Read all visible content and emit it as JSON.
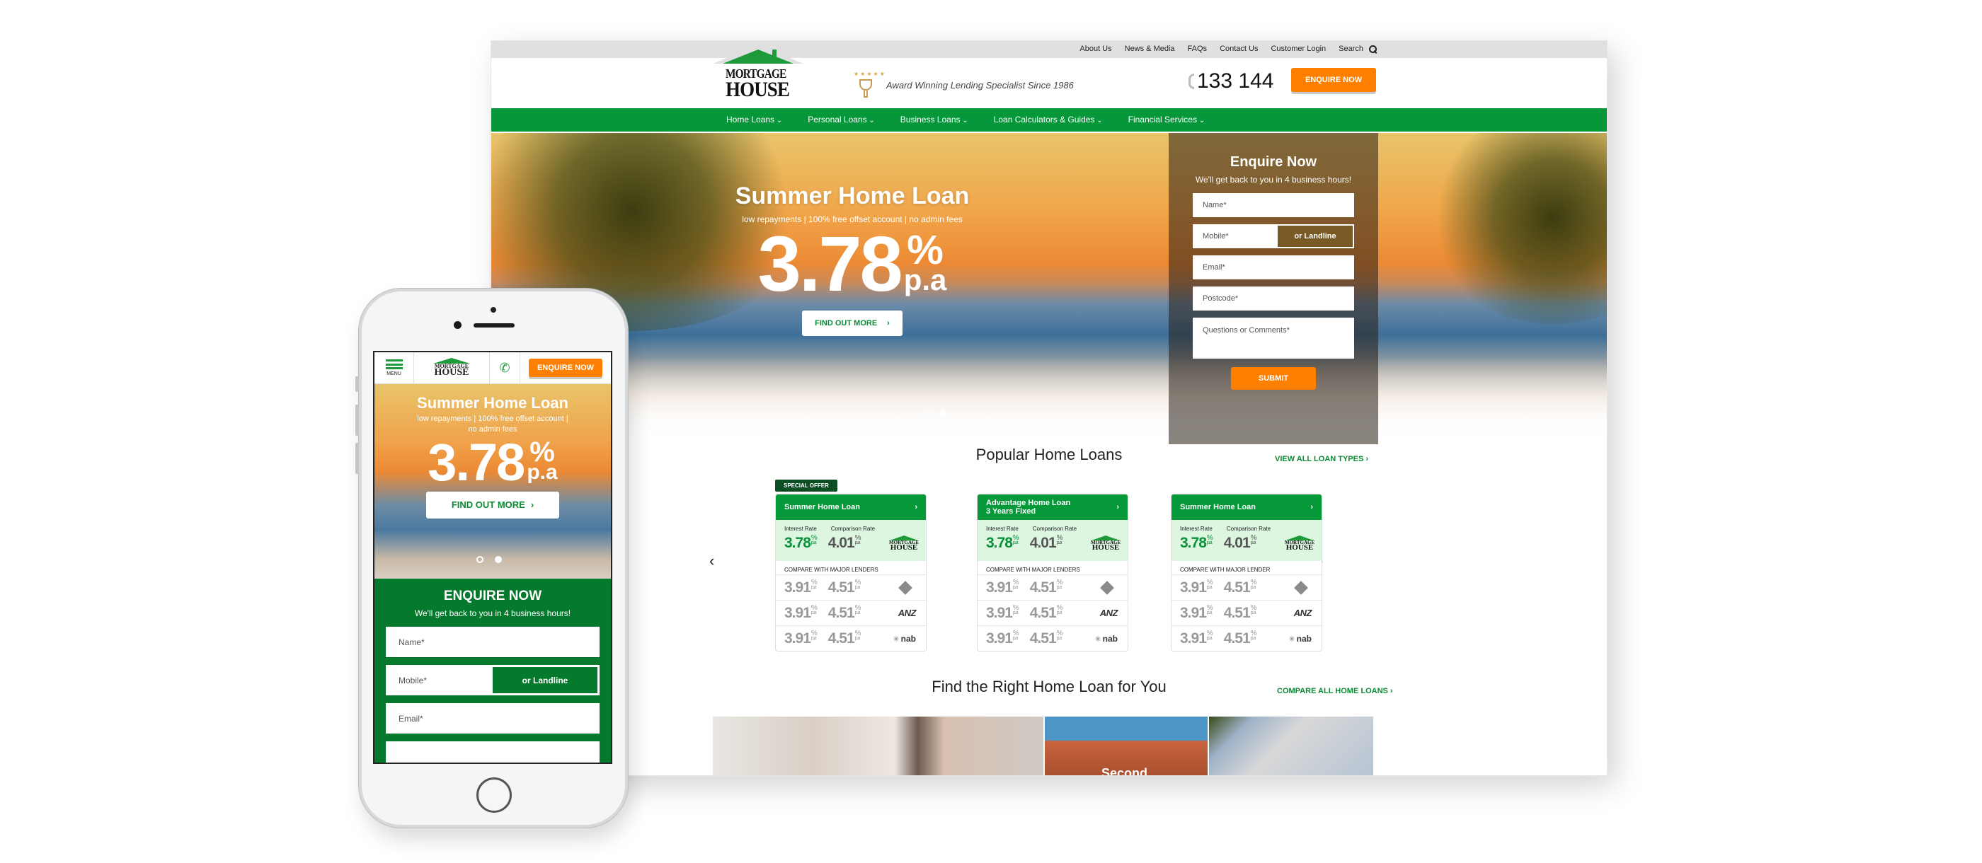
{
  "desktop": {
    "top_links": [
      "About Us",
      "News & Media",
      "FAQs",
      "Contact Us",
      "Customer Login",
      "Search"
    ],
    "logo": {
      "line1": "MORTGAGE",
      "line2": "HOUSE"
    },
    "award_text": "Award Winning Lending Specialist Since 1986",
    "phone_number": "133 144",
    "enquire_button": "ENQUIRE NOW",
    "nav": [
      "Home Loans",
      "Personal Loans",
      "Business Loans",
      "Loan Calculators & Guides",
      "Financial Services"
    ],
    "hero": {
      "title": "Summer Home Loan",
      "subtitle": "low repayments  |  100% free offset account  |  no admin fees",
      "rate": "3.78",
      "rate_unit": "%",
      "rate_suffix": "p.a",
      "cta": "FIND OUT MORE",
      "slides": 2,
      "active_slide": 2
    },
    "enquire_form": {
      "title": "Enquire Now",
      "subtitle": "We'll get back to you in 4 business hours!",
      "name_placeholder": "Name*",
      "mobile_placeholder": "Mobile*",
      "landline_toggle": "or Landline",
      "email_placeholder": "Email*",
      "postcode_placeholder": "Postcode*",
      "comments_placeholder": "Questions or Comments*",
      "submit": "SUBMIT"
    },
    "popular": {
      "title": "Popular Home Loans",
      "view_all": "VIEW ALL LOAN TYPES",
      "cards": [
        {
          "badge": "SPECIAL OFFER",
          "name": "Summer Home Loan",
          "interest_label": "Interest Rate",
          "comparison_label": "Comparison Rate",
          "interest_rate": "3.78",
          "comparison_rate": "4.01",
          "compare_title": "COMPARE WITH MAJOR LENDERS",
          "lenders": [
            {
              "name": "CBA",
              "interest": "3.91",
              "comparison": "4.51"
            },
            {
              "name": "ANZ",
              "interest": "3.91",
              "comparison": "4.51"
            },
            {
              "name": "nab",
              "interest": "3.91",
              "comparison": "4.51"
            }
          ]
        },
        {
          "badge": "",
          "name_line1": "Advantage Home Loan",
          "name_line2": "3 Years Fixed",
          "interest_label": "Interest Rate",
          "comparison_label": "Comparison Rate",
          "interest_rate": "3.78",
          "comparison_rate": "4.01",
          "compare_title": "COMPARE WITH MAJOR LENDERS",
          "lenders": [
            {
              "name": "CBA",
              "interest": "3.91",
              "comparison": "4.51"
            },
            {
              "name": "ANZ",
              "interest": "3.91",
              "comparison": "4.51"
            },
            {
              "name": "nab",
              "interest": "3.91",
              "comparison": "4.51"
            }
          ]
        },
        {
          "badge": "",
          "name": "Summer Home Loan",
          "interest_label": "Interest Rate",
          "comparison_label": "Comparison Rate",
          "interest_rate": "3.78",
          "comparison_rate": "4.01",
          "compare_title": "COMPARE WITH MAJOR LENDER",
          "lenders": [
            {
              "name": "CBA",
              "interest": "3.91",
              "comparison": "4.51"
            },
            {
              "name": "ANZ",
              "interest": "3.91",
              "comparison": "4.51"
            },
            {
              "name": "nab",
              "interest": "3.91",
              "comparison": "4.51"
            }
          ]
        }
      ],
      "pct": "%",
      "pa": "p.a"
    },
    "find": {
      "title": "Find the Right Home Loan for You",
      "compare_all": "COMPARE ALL HOME LOANS",
      "tile_label": "Second"
    }
  },
  "mobile": {
    "menu_label": "MENU",
    "logo": {
      "line1": "MORTGAGE",
      "line2": "HOUSE"
    },
    "enquire_button": "ENQUIRE NOW",
    "hero": {
      "title": "Summer Home Loan",
      "subtitle": "low repayments  |  100% free offset account  |  no admin fees",
      "rate": "3.78",
      "rate_unit": "%",
      "rate_suffix": "p.a",
      "cta": "FIND OUT MORE"
    },
    "enquire_form": {
      "title": "ENQUIRE NOW",
      "subtitle": "We'll get back to you in 4 business hours!",
      "name_placeholder": "Name*",
      "mobile_placeholder": "Mobile*",
      "landline_toggle": "or Landline",
      "email_placeholder": "Email*"
    }
  },
  "colors": {
    "brand_green": "#05973a",
    "dark_green": "#067a2c",
    "accent_orange": "#ff7f00",
    "light_green_bg": "#dcf6e0"
  }
}
